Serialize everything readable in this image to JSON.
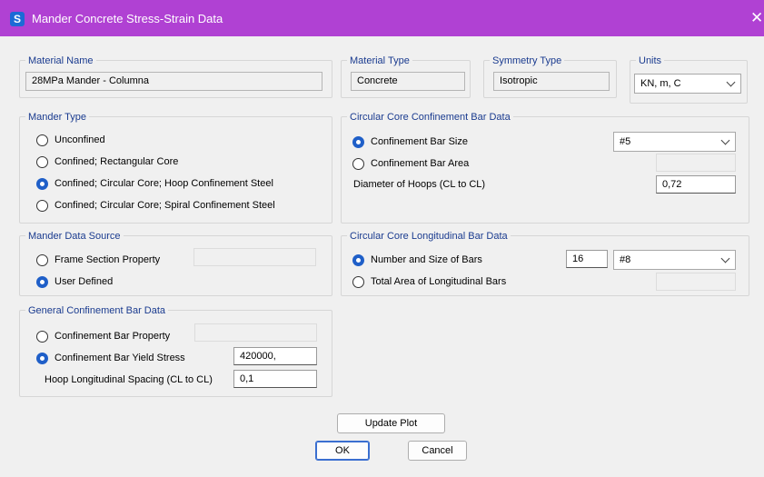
{
  "window": {
    "title": "Mander Concrete Stress-Strain Data",
    "app_icon_letter": "S",
    "close_glyph": "✕"
  },
  "material_name": {
    "title": "Material Name",
    "value": "28MPa Mander - Columna"
  },
  "material_type": {
    "title": "Material Type",
    "value": "Concrete"
  },
  "symmetry_type": {
    "title": "Symmetry Type",
    "value": "Isotropic"
  },
  "units": {
    "title": "Units",
    "value": "KN, m, C"
  },
  "mander_type": {
    "title": "Mander Type",
    "options": [
      {
        "label": "Unconfined",
        "selected": false
      },
      {
        "label": "Confined;  Rectangular Core",
        "selected": false
      },
      {
        "label": "Confined;  Circular Core;  Hoop Confinement Steel",
        "selected": true
      },
      {
        "label": "Confined;  Circular Core;  Spiral Confinement Steel",
        "selected": false
      }
    ]
  },
  "circular_core_confinement": {
    "title": "Circular Core Confinement Bar Data",
    "bar_size_label": "Confinement Bar Size",
    "bar_size_selected": true,
    "bar_size_value": "#5",
    "bar_area_label": "Confinement Bar Area",
    "bar_area_selected": false,
    "bar_area_value": "",
    "hoop_diameter_label": "Diameter of Hoops  (CL to CL)",
    "hoop_diameter_value": "0,72"
  },
  "mander_data_source": {
    "title": "Mander Data Source",
    "frame_section_label": "Frame Section Property",
    "frame_section_selected": false,
    "frame_section_value": "",
    "user_defined_label": "User Defined",
    "user_defined_selected": true
  },
  "circular_core_longitudinal": {
    "title": "Circular Core Longitudinal Bar Data",
    "number_size_label": "Number and Size of Bars",
    "number_size_selected": true,
    "number_of_bars": "16",
    "bar_size_value": "#8",
    "total_area_label": "Total Area of Longitudinal Bars",
    "total_area_selected": false,
    "total_area_value": ""
  },
  "general_confinement": {
    "title": "General Confinement Bar Data",
    "bar_property_label": "Confinement Bar Property",
    "bar_property_selected": false,
    "bar_property_value": "",
    "yield_stress_label": "Confinement Bar Yield Stress",
    "yield_stress_selected": true,
    "yield_stress_value": "420000,",
    "hoop_spacing_label": "Hoop Longitudinal Spacing  (CL to CL)",
    "hoop_spacing_value": "0,1"
  },
  "buttons": {
    "update_plot": "Update Plot",
    "ok": "OK",
    "cancel": "Cancel"
  },
  "colors": {
    "titlebar": "#b041d3",
    "group_title": "#1a3b8f",
    "radio_selected": "#1f5fc8",
    "app_icon": "#1c6ad6"
  }
}
